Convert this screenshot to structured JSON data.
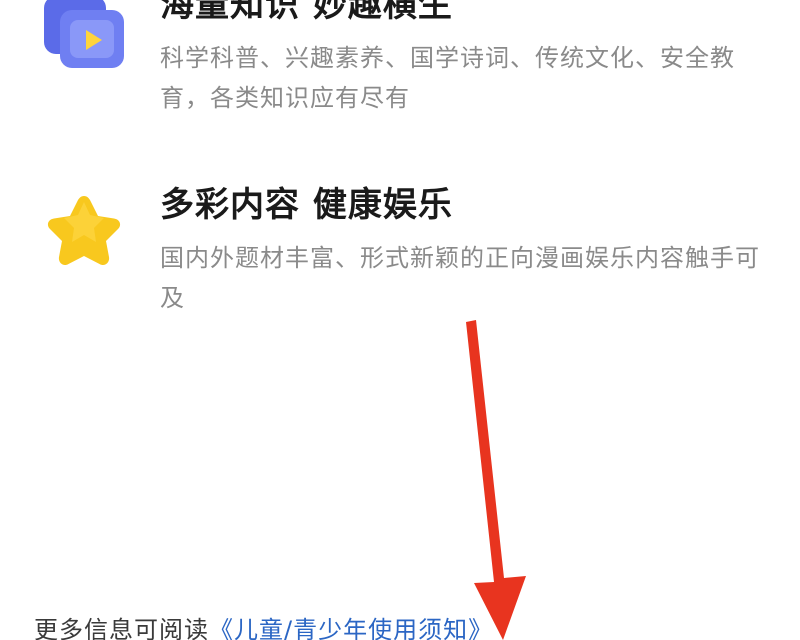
{
  "features": [
    {
      "icon": "video-folder-icon",
      "title": "海量知识 妙趣横生",
      "description": "科学科普、兴趣素养、国学诗词、传统文化、安全教育，各类知识应有尽有"
    },
    {
      "icon": "star-icon",
      "title": "多彩内容 健康娱乐",
      "description": "国内外题材丰富、形式新颖的正向漫画娱乐内容触手可及"
    }
  ],
  "footer": {
    "prefix": "更多信息可阅读",
    "link_text": "《儿童/青少年使用须知》"
  },
  "colors": {
    "title": "#1a1a1a",
    "description": "#8a8a8a",
    "link": "#2b66c4",
    "arrow": "#e8341f",
    "folder_back": "#5b6be8",
    "folder_front": "#7b8cf5",
    "play_icon": "#ffd43b",
    "star": "#f8c81e"
  }
}
